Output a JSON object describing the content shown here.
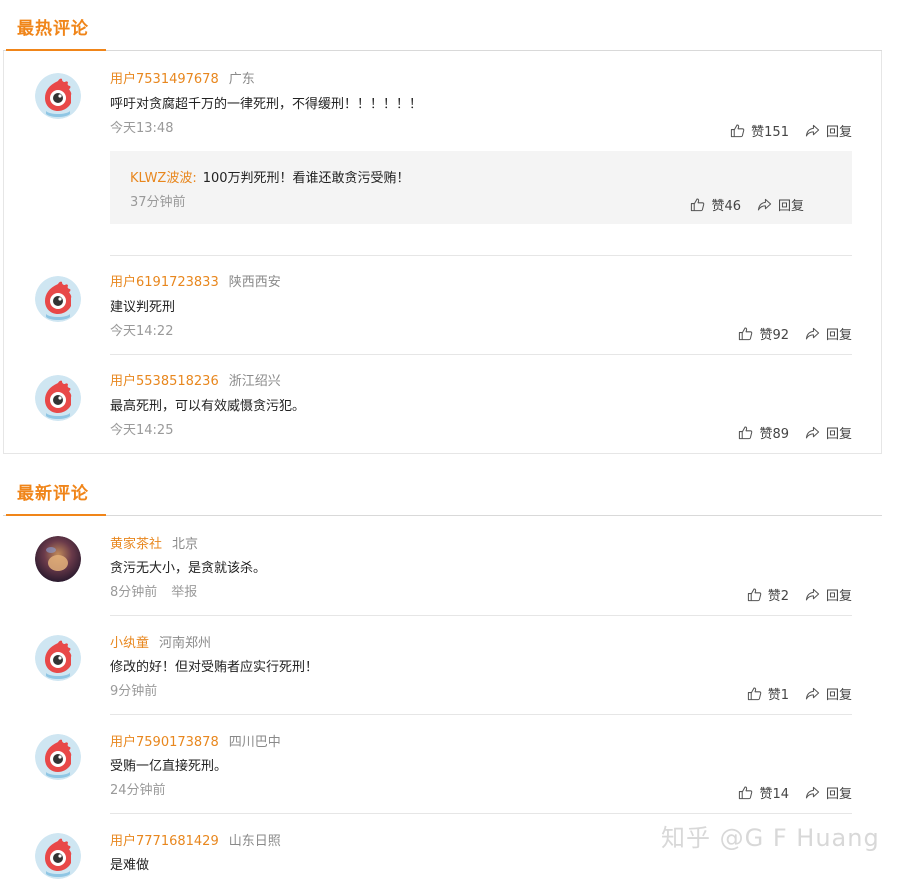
{
  "hot": {
    "title": "最热评论",
    "comments": [
      {
        "user": "用户7531497678",
        "location": "广东",
        "text": "呼吁对贪腐超千万的一律死刑，不得缓刑！！！！！！",
        "time": "今天13:48",
        "likes": "赞151",
        "reply": "回复",
        "sub_reply": {
          "user": "KLWZ波波:",
          "text": "100万判死刑！看谁还敢贪污受贿！",
          "time": "37分钟前",
          "likes": "赞46",
          "reply": "回复"
        }
      },
      {
        "user": "用户6191723833",
        "location": "陕西西安",
        "text": "建议判死刑",
        "time": "今天14:22",
        "likes": "赞92",
        "reply": "回复"
      },
      {
        "user": "用户5538518236",
        "location": "浙江绍兴",
        "text": "最高死刑，可以有效威慑贪污犯。",
        "time": "今天14:25",
        "likes": "赞89",
        "reply": "回复"
      }
    ]
  },
  "latest": {
    "title": "最新评论",
    "comments": [
      {
        "user": "黄家茶社",
        "location": "北京",
        "text": "贪污无大小，是贪就该杀。",
        "time": "8分钟前",
        "report": "举报",
        "likes": "赞2",
        "reply": "回复"
      },
      {
        "user": "小纨童",
        "location": "河南郑州",
        "text": "修改的好！但对受贿者应实行死刑！",
        "time": "9分钟前",
        "likes": "赞1",
        "reply": "回复"
      },
      {
        "user": "用户7590173878",
        "location": "四川巴中",
        "text": "受贿一亿直接死刑。",
        "time": "24分钟前",
        "likes": "赞14",
        "reply": "回复"
      },
      {
        "user": "用户7771681429",
        "location": "山东日照",
        "text": "是难做"
      }
    ]
  },
  "watermark": "知乎 @G F Huang",
  "colors": {
    "accent": "#f08519",
    "username": "#e8871e"
  }
}
